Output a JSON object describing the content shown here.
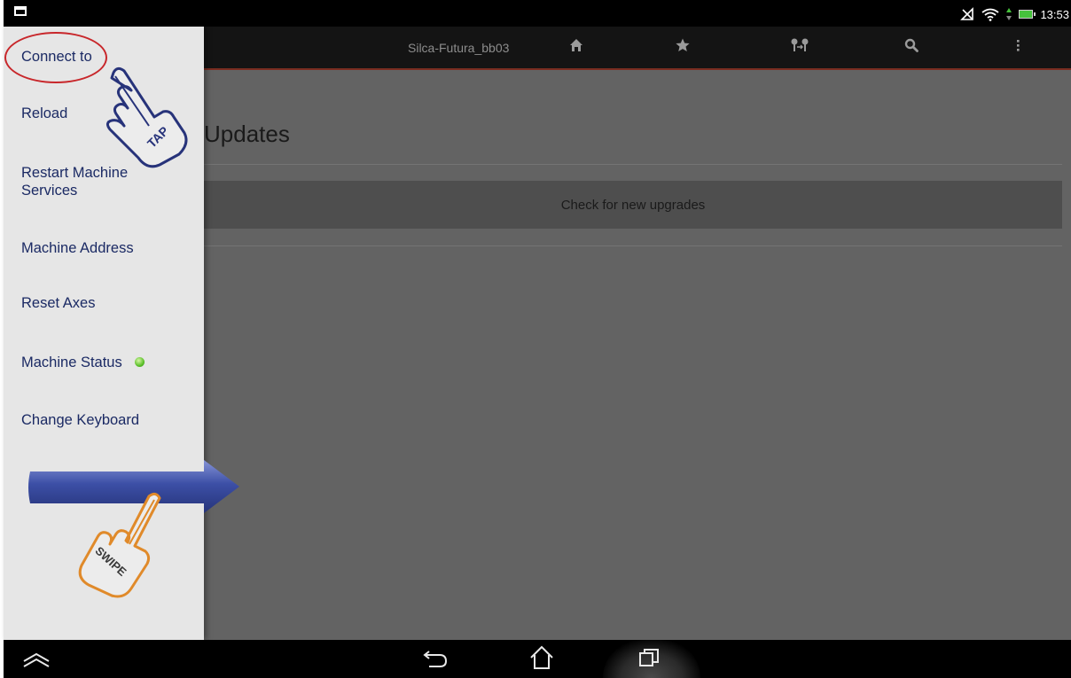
{
  "status_bar": {
    "time": "13:53",
    "icons": [
      "notification-icon",
      "no-signal-icon",
      "wifi-icon",
      "battery-icon"
    ]
  },
  "action_bar": {
    "title": "Silca-Futura_bb03",
    "icons": [
      "home-icon",
      "star-icon",
      "keys-icon",
      "search-icon",
      "overflow-menu-icon"
    ]
  },
  "drawer": {
    "items": [
      {
        "label": "Connect to"
      },
      {
        "label": "Reload"
      },
      {
        "label": "Restart Machine Services"
      },
      {
        "label": "Machine Address"
      },
      {
        "label": "Reset Axes"
      },
      {
        "label": "Machine Status"
      },
      {
        "label": "Change Keyboard"
      }
    ]
  },
  "main": {
    "heading": "Updates",
    "check_button": "Check for new upgrades"
  },
  "overlays": {
    "tap_label": "TAP",
    "swipe_label": "SWIPE"
  },
  "nav_bar": {
    "icons": [
      "hide-keyboard-icon",
      "back-icon",
      "home-icon",
      "recents-icon"
    ]
  },
  "colors": {
    "accent_line": "#7a2d21",
    "drawer_text": "#1b2a64",
    "highlight_circle": "#c8272b",
    "swipe_arrow": "#3c4fa6",
    "status_dot": "#5cc02a"
  }
}
